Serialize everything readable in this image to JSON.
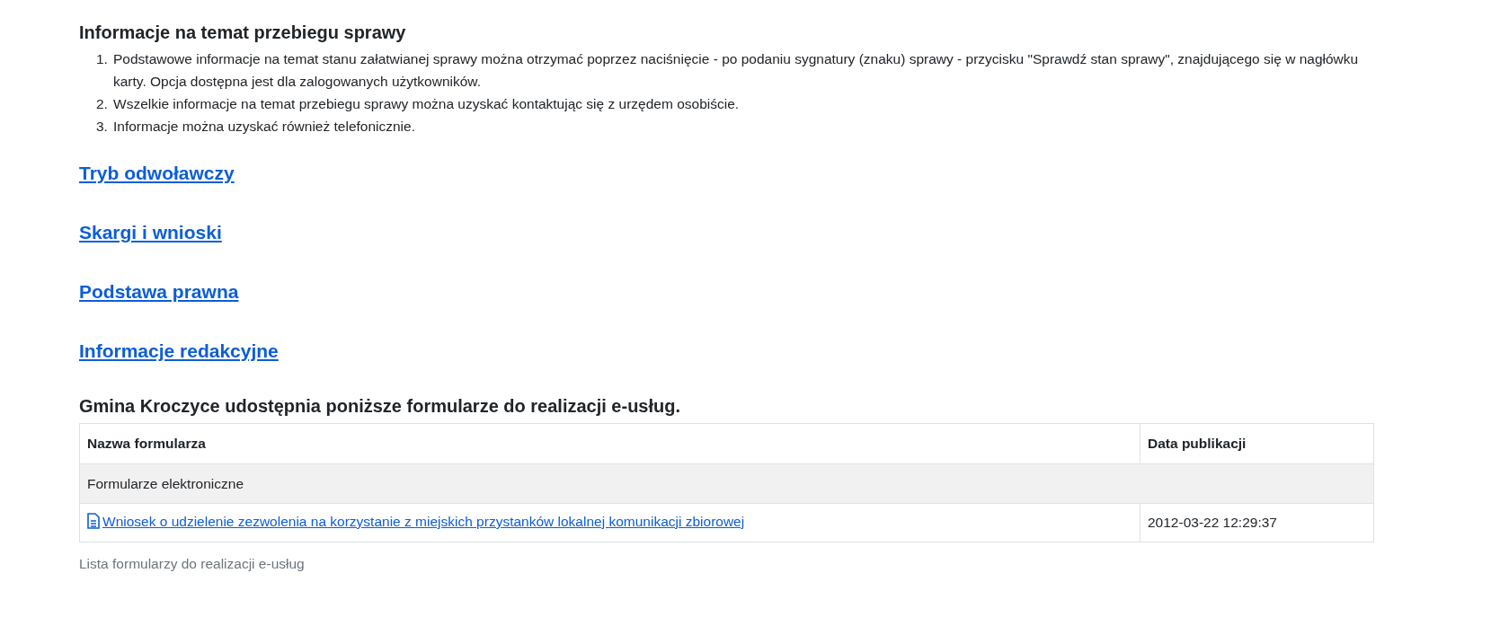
{
  "section_title": "Informacje na temat przebiegu sprawy",
  "steps": [
    {
      "number": "1.",
      "text": "Podstawowe informacje na temat stanu załatwianej sprawy można otrzymać poprzez naciśnięcie - po podaniu sygnatury (znaku) sprawy - przycisku \"Sprawdź stan sprawy\", znajdującego się w nagłówku karty. Opcja dostępna jest dla zalogowanych użytkowników."
    },
    {
      "number": "2.",
      "text": "Wszelkie informacje na temat przebiegu sprawy można uzyskać kontaktując się z urzędem osobiście."
    },
    {
      "number": "3.",
      "text": "Informacje można uzyskać również telefonicznie."
    }
  ],
  "section_links": [
    "Tryb odwoławczy",
    "Skargi i wnioski",
    "Podstawa prawna",
    "Informacje redakcyjne"
  ],
  "forms_title": "Gmina Kroczyce udostępnia poniższe formularze do realizacji e-usług.",
  "table": {
    "columns": [
      "Nazwa formularza",
      "Data publikacji"
    ],
    "rows": [
      {
        "kind": "group",
        "label": "Formularze elektroniczne"
      },
      {
        "kind": "form",
        "name": "Wniosek o udzielenie zezwolenia na korzystanie z miejskich przystanków lokalnej komunikacji zbiorowej",
        "date": "2012-03-22 12:29:37"
      }
    ],
    "caption": "Lista formularzy do realizacji e-usług"
  }
}
